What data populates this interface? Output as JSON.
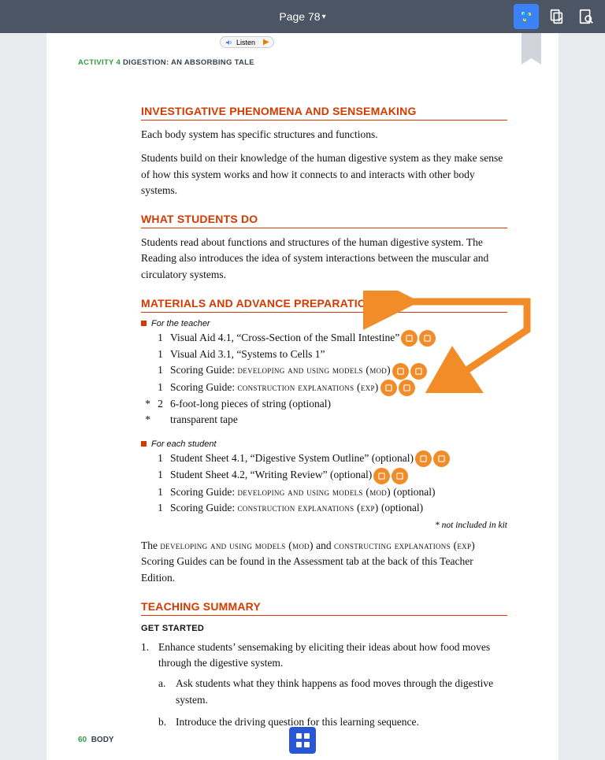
{
  "topbar": {
    "page_label": "Page 78"
  },
  "activity": {
    "num_label": "ACTIVITY 4",
    "title": "DIGESTION: AN ABSORBING TALE"
  },
  "listen": {
    "label": "Listen"
  },
  "sections": {
    "investigative": {
      "title": "INVESTIGATIVE PHENOMENA AND SENSEMAKING",
      "p1": "Each body system has specific structures and functions.",
      "p2": "Students build on their knowledge of the human digestive system as they make sense of how this system works and how it connects to and interacts with other body systems."
    },
    "what_students_do": {
      "title": "WHAT STUDENTS DO",
      "p1": "Students read about functions and structures of the human digestive system. The Reading also introduces the idea of system interactions between the muscular and circulatory systems."
    },
    "materials": {
      "title": "MATERIALS AND ADVANCE PREPARATION",
      "teacher_label": "For the teacher",
      "teacher": {
        "r0": {
          "qty": "1",
          "name": "Visual Aid 4.1, “Cross-Section of the Small Intestine”"
        },
        "r1": {
          "qty": "1",
          "name": "Visual Aid 3.1, “Systems to Cells 1”"
        },
        "r2": {
          "qty": "1",
          "prefix": "Scoring Guide: ",
          "caps": "developing and using models (mod)"
        },
        "r3": {
          "qty": "1",
          "prefix": "Scoring Guide: ",
          "caps": "construction explanations (exp)"
        },
        "r4": {
          "star": "*",
          "qty": "2",
          "name": "6-foot-long pieces of string (optional)"
        },
        "r5": {
          "star": "*",
          "qty": "",
          "name": "transparent tape"
        }
      },
      "student_label": "For each student",
      "student": {
        "r0": {
          "qty": "1",
          "name": "Student Sheet 4.1, “Digestive System Outline” (optional)"
        },
        "r1": {
          "qty": "1",
          "name": "Student Sheet 4.2, “Writing Review” (optional)"
        },
        "r2": {
          "qty": "1",
          "prefix": "Scoring Guide: ",
          "caps": "developing and using models (mod)",
          "suffix": " (optional)"
        },
        "r3": {
          "qty": "1",
          "prefix": "Scoring Guide: ",
          "caps": "construction explanations (exp)",
          "suffix": " (optional)"
        }
      },
      "kit_note": "* not included in kit",
      "para_prefix": "The ",
      "para_caps1": "developing and using models (mod)",
      "para_mid": " and ",
      "para_caps2": "constructing explanations (exp)",
      "para_suffix": " Scoring Guides can be found in the Assessment tab at the back of this Teacher Edition."
    },
    "teaching_summary": {
      "title": "TEACHING SUMMARY",
      "get_started": "GET STARTED",
      "item1": "Enhance students’ sensemaking by eliciting their ideas about how food moves through the digestive system.",
      "item1a": "Ask students what they think happens as food moves through the digestive system.",
      "item1b": "Introduce the driving question for this learning sequence."
    }
  },
  "footer": {
    "num": "60",
    "label": "BODY"
  }
}
